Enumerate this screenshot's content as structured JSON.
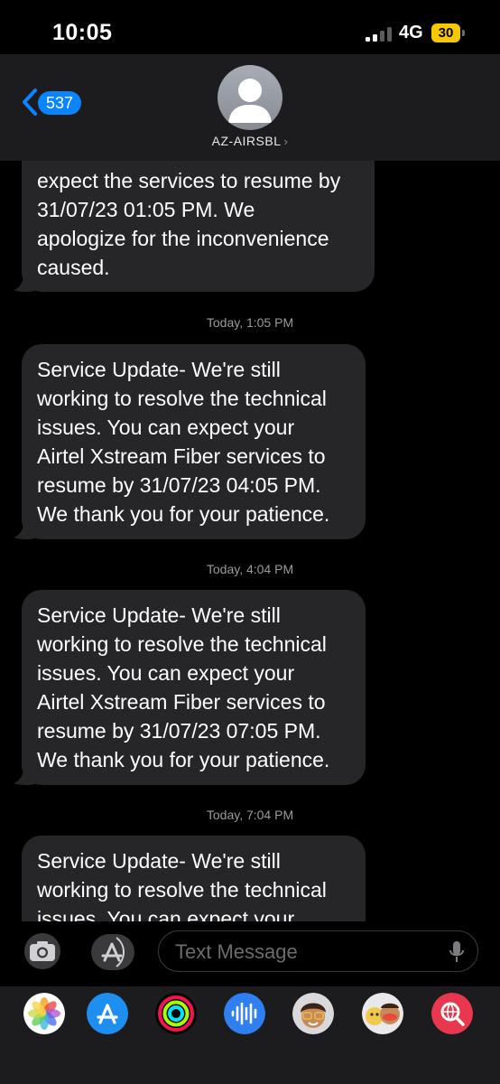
{
  "status": {
    "time": "10:05",
    "network": "4G",
    "battery": "30"
  },
  "header": {
    "back_count": "537",
    "contact": "AZ-AIRSBL"
  },
  "messages": [
    {
      "lines": [
        "expect the services to resume by",
        "31/07/23 01:05 PM. We",
        "apologize for the inconvenience",
        "caused."
      ]
    },
    {
      "timestamp": "Today, 1:05 PM",
      "lines": [
        "Service Update- We're still",
        "working to resolve the technical",
        "issues. You can expect your",
        "Airtel Xstream Fiber services to",
        "resume by 31/07/23 04:05 PM.",
        "We thank you for your patience."
      ]
    },
    {
      "timestamp": "Today, 4:04 PM",
      "lines": [
        "Service Update- We're still",
        "working to resolve the technical",
        "issues. You can expect your",
        "Airtel Xstream Fiber services to",
        "resume by 31/07/23 07:05 PM.",
        "We thank you for your patience."
      ]
    },
    {
      "timestamp": "Today, 7:04 PM",
      "lines": [
        "Service Update- We're still",
        "working to resolve the technical",
        "issues. You can expect your"
      ]
    }
  ],
  "input": {
    "placeholder": "Text Message"
  },
  "app_strip": [
    "photos-app-icon",
    "app-store-app-icon",
    "fitness-app-icon",
    "audio-message-app-icon",
    "memoji-app-icon",
    "animoji-app-icon",
    "web-search-app-icon"
  ],
  "colors": {
    "bubble": "#262628",
    "accent": "#0a84ff",
    "background": "#000000"
  }
}
